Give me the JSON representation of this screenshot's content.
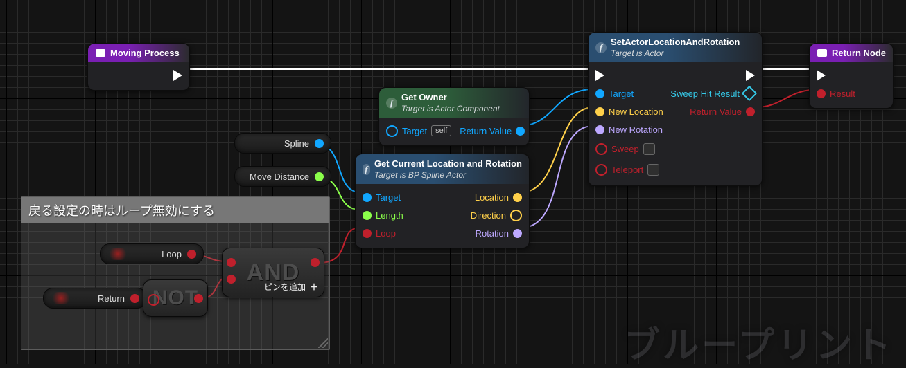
{
  "comment": {
    "title": "戻る設定の時はループ無効にする"
  },
  "nodes": {
    "movingProcess": {
      "title": "Moving Process"
    },
    "returnNode": {
      "title": "Return Node",
      "pins": {
        "result": "Result"
      }
    },
    "getOwner": {
      "title": "Get Owner",
      "subtitle": "Target is Actor Component",
      "pins": {
        "target": "Target",
        "targetValue": "self",
        "returnValue": "Return Value"
      }
    },
    "getLocRot": {
      "title": "Get Current Location and Rotation",
      "subtitle": "Target is BP Spline Actor",
      "pins": {
        "target": "Target",
        "length": "Length",
        "loop": "Loop",
        "location": "Location",
        "direction": "Direction",
        "rotation": "Rotation"
      }
    },
    "setLocRot": {
      "title": "SetActorLocationAndRotation",
      "subtitle": "Target is Actor",
      "pins": {
        "target": "Target",
        "newLocation": "New Location",
        "newRotation": "New Rotation",
        "sweep": "Sweep",
        "teleport": "Teleport",
        "sweepHit": "Sweep Hit Result",
        "returnValue": "Return Value"
      }
    }
  },
  "vars": {
    "spline": "Spline",
    "moveDistance": "Move Distance",
    "loop": "Loop",
    "return": "Return"
  },
  "ops": {
    "not": "NOT",
    "and": "AND",
    "addPin": "ピンを追加"
  },
  "watermark": "ブループリント"
}
